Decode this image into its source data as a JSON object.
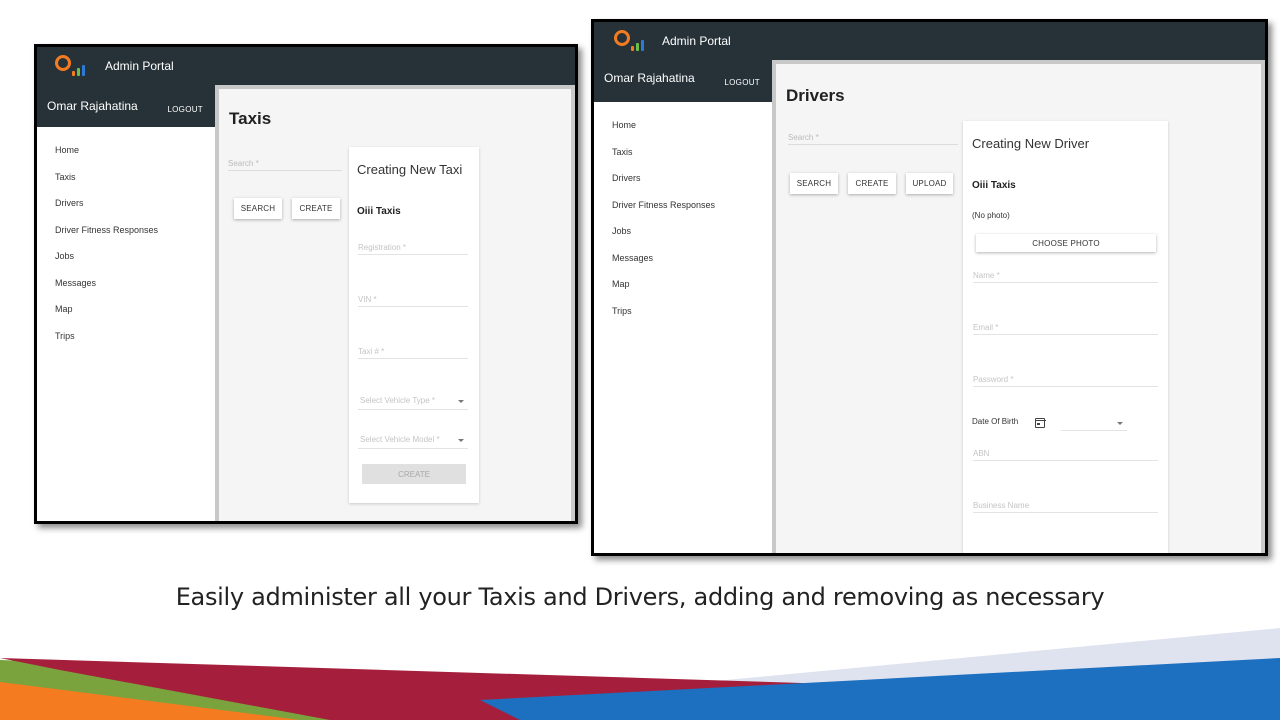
{
  "colors": {
    "topbar": "#263238",
    "accent_orange": "#f47b20",
    "accent_green": "#6cc04a",
    "accent_blue": "#2b7bd6",
    "banner_red": "#a51f3c",
    "banner_blue": "#1d6fbf",
    "banner_light": "#dfe3ef"
  },
  "shared": {
    "logo_icon": "oiii-logo-icon",
    "app_title": "Admin Portal",
    "user_name": "Omar Rajahatina",
    "logout_label": "LOGOUT",
    "nav_items": [
      "Home",
      "Taxis",
      "Drivers",
      "Driver Fitness Responses",
      "Jobs",
      "Messages",
      "Map",
      "Trips"
    ]
  },
  "taxis_screen": {
    "page_title": "Taxis",
    "search_placeholder": "Search *",
    "search_button": "SEARCH",
    "create_button": "CREATE",
    "form": {
      "title": "Creating New Taxi",
      "brand": "Oiii Taxis",
      "registration_placeholder": "Registration *",
      "vin_placeholder": "VIN *",
      "taxi_number_placeholder": "Taxi # *",
      "vehicle_type_placeholder": "Select Vehicle Type *",
      "vehicle_model_placeholder": "Select Vehicle Model *",
      "submit_label": "CREATE"
    }
  },
  "drivers_screen": {
    "page_title": "Drivers",
    "search_placeholder": "Search *",
    "search_button": "SEARCH",
    "create_button": "CREATE",
    "upload_button": "UPLOAD",
    "form": {
      "title": "Creating New Driver",
      "brand": "Oiii Taxis",
      "photo_status": "(No photo)",
      "choose_photo_label": "CHOOSE PHOTO",
      "name_placeholder": "Name *",
      "email_placeholder": "Email *",
      "password_placeholder": "Password *",
      "dob_label": "Date Of Birth",
      "dob_icon": "calendar-icon",
      "abn_placeholder": "ABN",
      "business_name_placeholder": "Business Name"
    }
  },
  "caption": "Easily administer all your Taxis and Drivers, adding and removing as necessary"
}
